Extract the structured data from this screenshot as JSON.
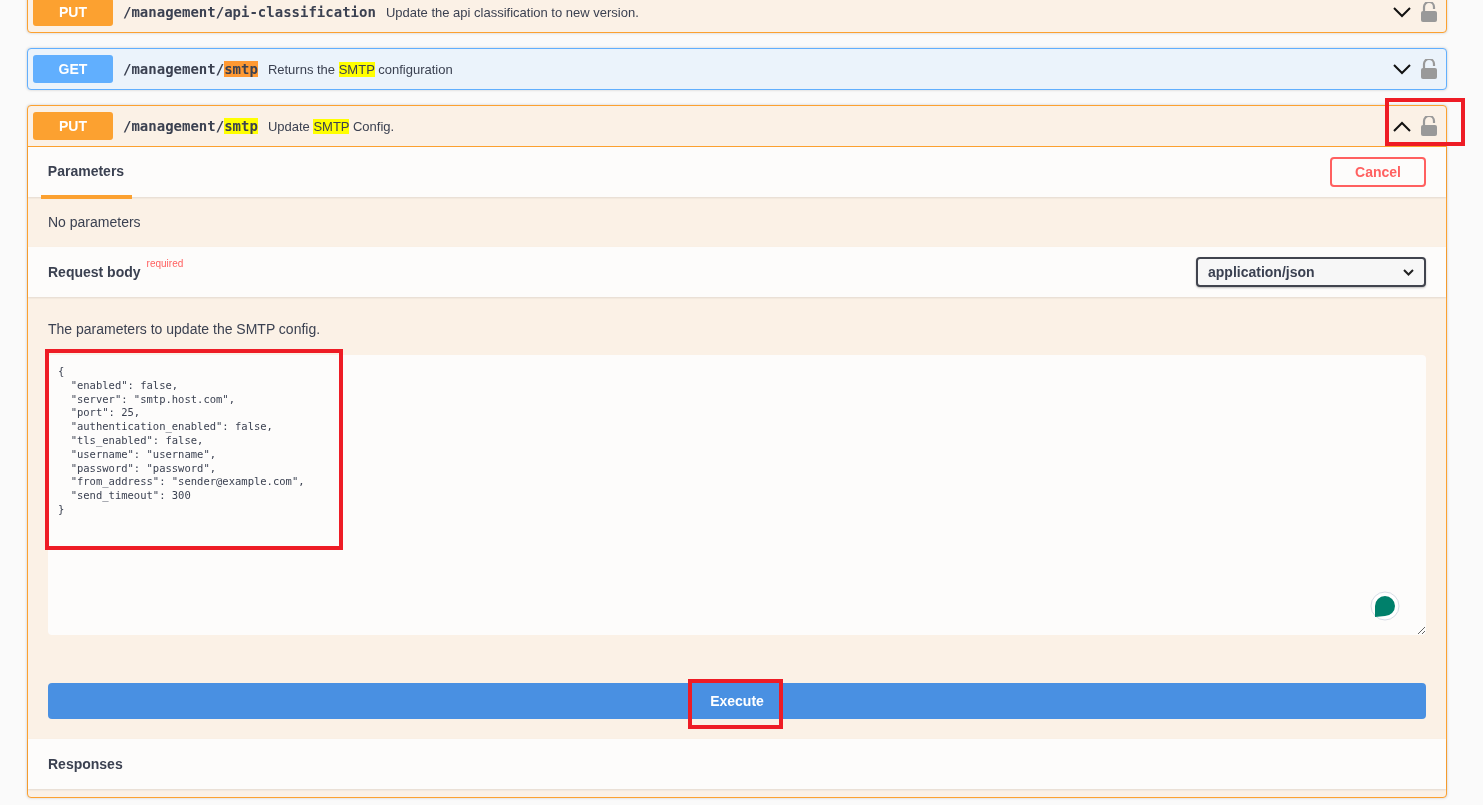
{
  "operations": [
    {
      "method": "PUT",
      "path": [
        {
          "text": "/management/api-classification"
        }
      ],
      "summary": [
        {
          "text": "Update the api classification to new version."
        }
      ],
      "expanded": false,
      "locked": false
    },
    {
      "method": "GET",
      "path": [
        {
          "text": "/management/"
        },
        {
          "text": "smtp",
          "color": "#ff9933"
        }
      ],
      "summary": [
        {
          "text": "Returns the "
        },
        {
          "text": "SMTP",
          "color": "#ffff00"
        },
        {
          "text": " configuration"
        }
      ],
      "expanded": false,
      "locked": false
    },
    {
      "method": "PUT",
      "path": [
        {
          "text": "/management/"
        },
        {
          "text": "smtp",
          "color": "#ffff00"
        }
      ],
      "summary": [
        {
          "text": "Update "
        },
        {
          "text": "SMTP",
          "color": "#ffff00"
        },
        {
          "text": " Config."
        }
      ],
      "expanded": true,
      "locked": false
    }
  ],
  "details": {
    "tabs": [
      {
        "label": "Parameters",
        "selected": true
      }
    ],
    "cancel_button": "Cancel",
    "parameters_text": "No parameters",
    "request_body": {
      "title": "Request body",
      "required": "required",
      "content_type": "application/json",
      "description": "The parameters to update the SMTP config.",
      "code": [
        "{",
        "  \"enabled\": false,",
        "  \"server\": \"smtp.host.com\",",
        "  \"port\": 25,",
        "  \"authentication_enabled\": false,",
        "  \"tls_enabled\": false,",
        "  \"username\": \"username\",",
        "  \"password\": \"password\",",
        "  \"from_address\": \"sender@example.com\",",
        "  \"send_timeout\": 300",
        "}"
      ]
    },
    "execute_button": "Execute",
    "responses_title": "Responses"
  }
}
